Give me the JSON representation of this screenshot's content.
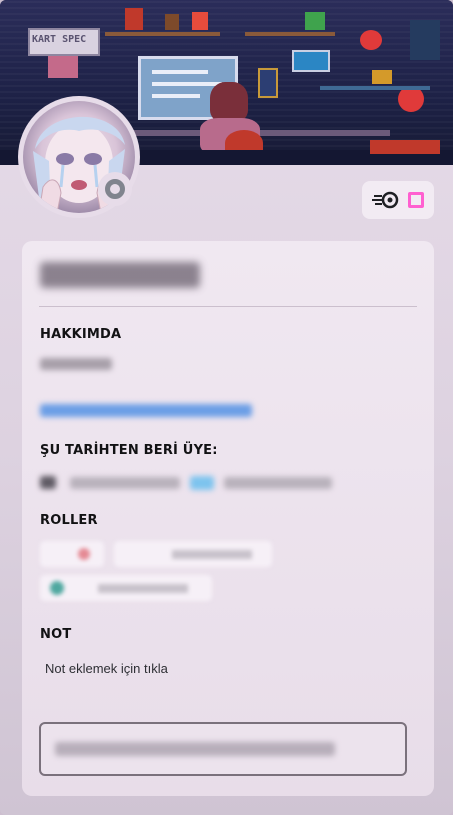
{
  "profile": {
    "username": "",
    "about_heading": "HAKKIMDA",
    "member_since_heading": "ŞU TARİHTEN BERİ ÜYE:",
    "roles_heading": "ROLLER",
    "note_heading": "NOT",
    "note_placeholder": "Not eklemek için tıkla",
    "message_placeholder": ""
  },
  "banner": {
    "sign_text": "KART SPEC"
  },
  "status": {
    "type": "offline",
    "icon": "status-ring-icon",
    "color": "#80848e"
  },
  "badges": [
    {
      "icon": "hypesquad-icon"
    },
    {
      "icon": "nitro-frame-icon",
      "color": "#ff5fd0"
    }
  ],
  "colors": {
    "card_bg": "#e7dce9",
    "link": "#4a8ee6",
    "heading_text": "#121214"
  }
}
